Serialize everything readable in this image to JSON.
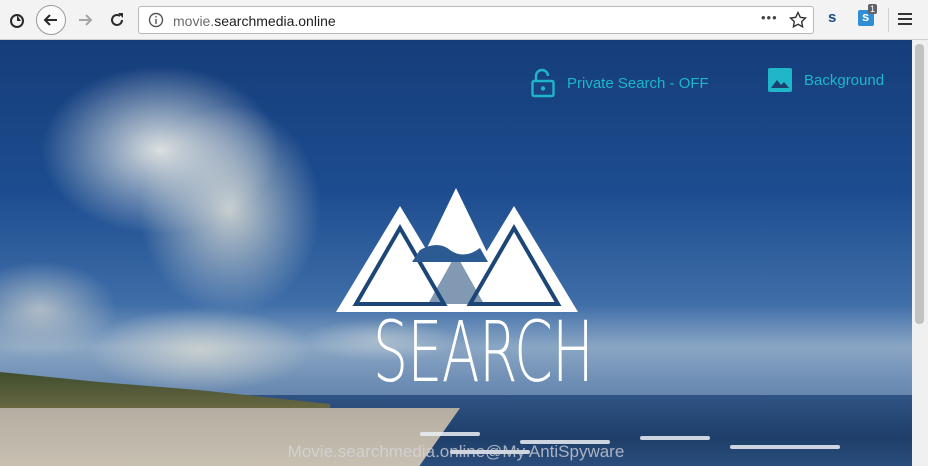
{
  "browser": {
    "url_prefix": "movie.",
    "url_domain": "searchmedia.online",
    "menu_dots": "•••",
    "ext_badge": "1"
  },
  "page": {
    "private_search_label": "Private Search -  OFF",
    "background_label": "Background",
    "logo_text": "SEARCH",
    "watermark": "Movie.searchmedia.online@My AntiSpyware"
  },
  "colors": {
    "accent": "#1fb6c9"
  }
}
